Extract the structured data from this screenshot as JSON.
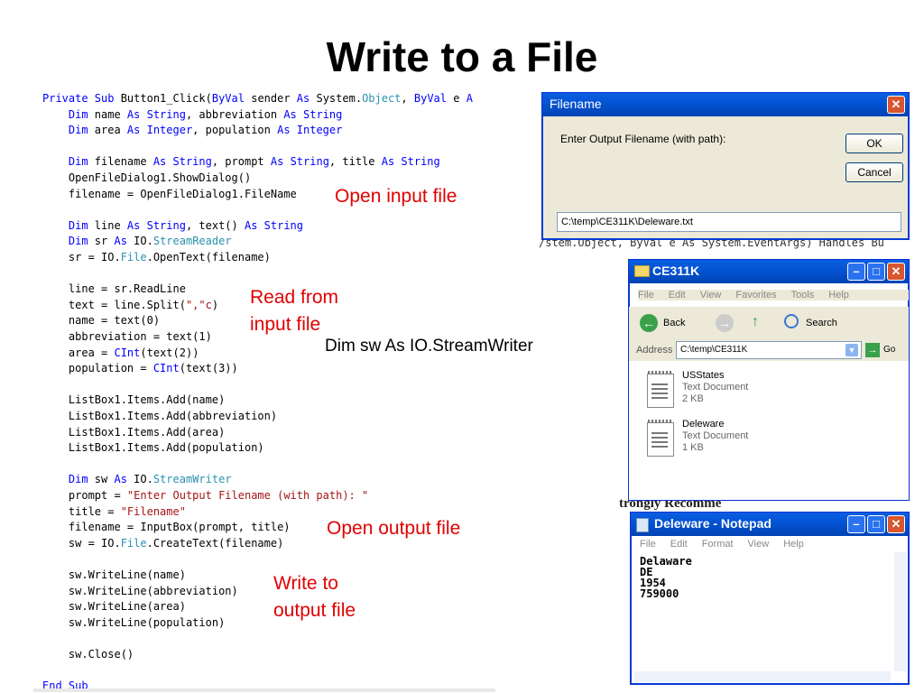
{
  "slide": {
    "title": "Write to a File"
  },
  "code": {
    "lines": [
      [
        {
          "t": "Private Sub ",
          "c": "kw"
        },
        {
          "t": "Button1_Click(",
          "c": ""
        },
        {
          "t": "ByVal ",
          "c": "kw"
        },
        {
          "t": "sender ",
          "c": ""
        },
        {
          "t": "As ",
          "c": "kw"
        },
        {
          "t": "System.",
          "c": ""
        },
        {
          "t": "Object",
          "c": "ty"
        },
        {
          "t": ", ",
          "c": ""
        },
        {
          "t": "ByVal ",
          "c": "kw"
        },
        {
          "t": "e ",
          "c": ""
        },
        {
          "t": "A",
          "c": "kw"
        }
      ],
      [
        {
          "t": "    Dim ",
          "c": "kw"
        },
        {
          "t": "name ",
          "c": ""
        },
        {
          "t": "As String",
          "c": "kw"
        },
        {
          "t": ", abbreviation ",
          "c": ""
        },
        {
          "t": "As String",
          "c": "kw"
        }
      ],
      [
        {
          "t": "    Dim ",
          "c": "kw"
        },
        {
          "t": "area ",
          "c": ""
        },
        {
          "t": "As Integer",
          "c": "kw"
        },
        {
          "t": ", population ",
          "c": ""
        },
        {
          "t": "As Integer",
          "c": "kw"
        }
      ],
      [],
      [
        {
          "t": "    Dim ",
          "c": "kw"
        },
        {
          "t": "filename ",
          "c": ""
        },
        {
          "t": "As String",
          "c": "kw"
        },
        {
          "t": ", prompt ",
          "c": ""
        },
        {
          "t": "As String",
          "c": "kw"
        },
        {
          "t": ", title ",
          "c": ""
        },
        {
          "t": "As String",
          "c": "kw"
        }
      ],
      [
        {
          "t": "    OpenFileDialog1.ShowDialog()",
          "c": ""
        }
      ],
      [
        {
          "t": "    filename = OpenFileDialog1.FileName",
          "c": ""
        }
      ],
      [],
      [
        {
          "t": "    Dim ",
          "c": "kw"
        },
        {
          "t": "line ",
          "c": ""
        },
        {
          "t": "As String",
          "c": "kw"
        },
        {
          "t": ", text() ",
          "c": ""
        },
        {
          "t": "As String",
          "c": "kw"
        }
      ],
      [
        {
          "t": "    Dim ",
          "c": "kw"
        },
        {
          "t": "sr ",
          "c": ""
        },
        {
          "t": "As ",
          "c": "kw"
        },
        {
          "t": "IO.",
          "c": ""
        },
        {
          "t": "StreamReader",
          "c": "ty"
        }
      ],
      [
        {
          "t": "    sr = IO.",
          "c": ""
        },
        {
          "t": "File",
          "c": "ty"
        },
        {
          "t": ".OpenText(filename)",
          "c": ""
        }
      ],
      [],
      [
        {
          "t": "    line = sr.ReadLine",
          "c": ""
        }
      ],
      [
        {
          "t": "    text = line.Split(",
          "c": ""
        },
        {
          "t": "\",\"c",
          "c": "st"
        },
        {
          "t": ")",
          "c": ""
        }
      ],
      [
        {
          "t": "    name = text(0)",
          "c": ""
        }
      ],
      [
        {
          "t": "    abbreviation = text(1)",
          "c": ""
        }
      ],
      [
        {
          "t": "    area = ",
          "c": ""
        },
        {
          "t": "CInt",
          "c": "kw"
        },
        {
          "t": "(text(2))",
          "c": ""
        }
      ],
      [
        {
          "t": "    population = ",
          "c": ""
        },
        {
          "t": "CInt",
          "c": "kw"
        },
        {
          "t": "(text(3))",
          "c": ""
        }
      ],
      [],
      [
        {
          "t": "    ListBox1.Items.Add(name)",
          "c": ""
        }
      ],
      [
        {
          "t": "    ListBox1.Items.Add(abbreviation)",
          "c": ""
        }
      ],
      [
        {
          "t": "    ListBox1.Items.Add(area)",
          "c": ""
        }
      ],
      [
        {
          "t": "    ListBox1.Items.Add(population)",
          "c": ""
        }
      ],
      [],
      [
        {
          "t": "    Dim ",
          "c": "kw"
        },
        {
          "t": "sw ",
          "c": ""
        },
        {
          "t": "As ",
          "c": "kw"
        },
        {
          "t": "IO.",
          "c": ""
        },
        {
          "t": "StreamWriter",
          "c": "ty"
        }
      ],
      [
        {
          "t": "    prompt = ",
          "c": ""
        },
        {
          "t": "\"Enter Output Filename (with path): \"",
          "c": "st"
        }
      ],
      [
        {
          "t": "    title = ",
          "c": ""
        },
        {
          "t": "\"Filename\"",
          "c": "st"
        }
      ],
      [
        {
          "t": "    filename = InputBox(prompt, title)",
          "c": ""
        }
      ],
      [
        {
          "t": "    sw = IO.",
          "c": ""
        },
        {
          "t": "File",
          "c": "ty"
        },
        {
          "t": ".CreateText(filename)",
          "c": ""
        }
      ],
      [],
      [
        {
          "t": "    sw.WriteLine(name)",
          "c": ""
        }
      ],
      [
        {
          "t": "    sw.WriteLine(abbreviation)",
          "c": ""
        }
      ],
      [
        {
          "t": "    sw.WriteLine(area)",
          "c": ""
        }
      ],
      [
        {
          "t": "    sw.WriteLine(population)",
          "c": ""
        }
      ],
      [],
      [
        {
          "t": "    sw.Close()",
          "c": ""
        }
      ],
      [],
      [
        {
          "t": "End Sub",
          "c": "kw"
        }
      ]
    ]
  },
  "annotations": {
    "open_input": "Open input file",
    "read_from": "Read from",
    "input_file": "input file",
    "dim_sw": "Dim sw As IO.StreamWriter",
    "open_output": "Open output file",
    "write_to": "Write to",
    "output_file": "output file"
  },
  "dialog": {
    "title": "Filename",
    "prompt": "Enter Output Filename (with path):",
    "ok": "OK",
    "cancel": "Cancel",
    "input_value": "C:\\temp\\CE311K\\Deleware.txt"
  },
  "explorer": {
    "title": "CE311K",
    "menu": [
      "File",
      "Edit",
      "View",
      "Favorites",
      "Tools",
      "Help"
    ],
    "back": "Back",
    "search": "Search",
    "address_label": "Address",
    "address": "C:\\temp\\CE311K",
    "go": "Go",
    "files": [
      {
        "name": "USStates",
        "type": "Text Document",
        "size": "2 KB"
      },
      {
        "name": "Deleware",
        "type": "Text Document",
        "size": "1 KB"
      }
    ]
  },
  "notepad": {
    "title": "Deleware - Notepad",
    "menu": [
      "File",
      "Edit",
      "Format",
      "View",
      "Help"
    ],
    "lines": [
      "Delaware",
      "DE",
      "1954",
      "759000"
    ]
  },
  "background": {
    "code_fragment": "/stem.Object, ByVal e As System.EventArgs) Handles Bu",
    "text_fragment": "trongly Recomme"
  },
  "colors": {
    "xp_blue": "#0454d4",
    "close_red": "#d8562e",
    "annotation_red": "#e00000"
  }
}
